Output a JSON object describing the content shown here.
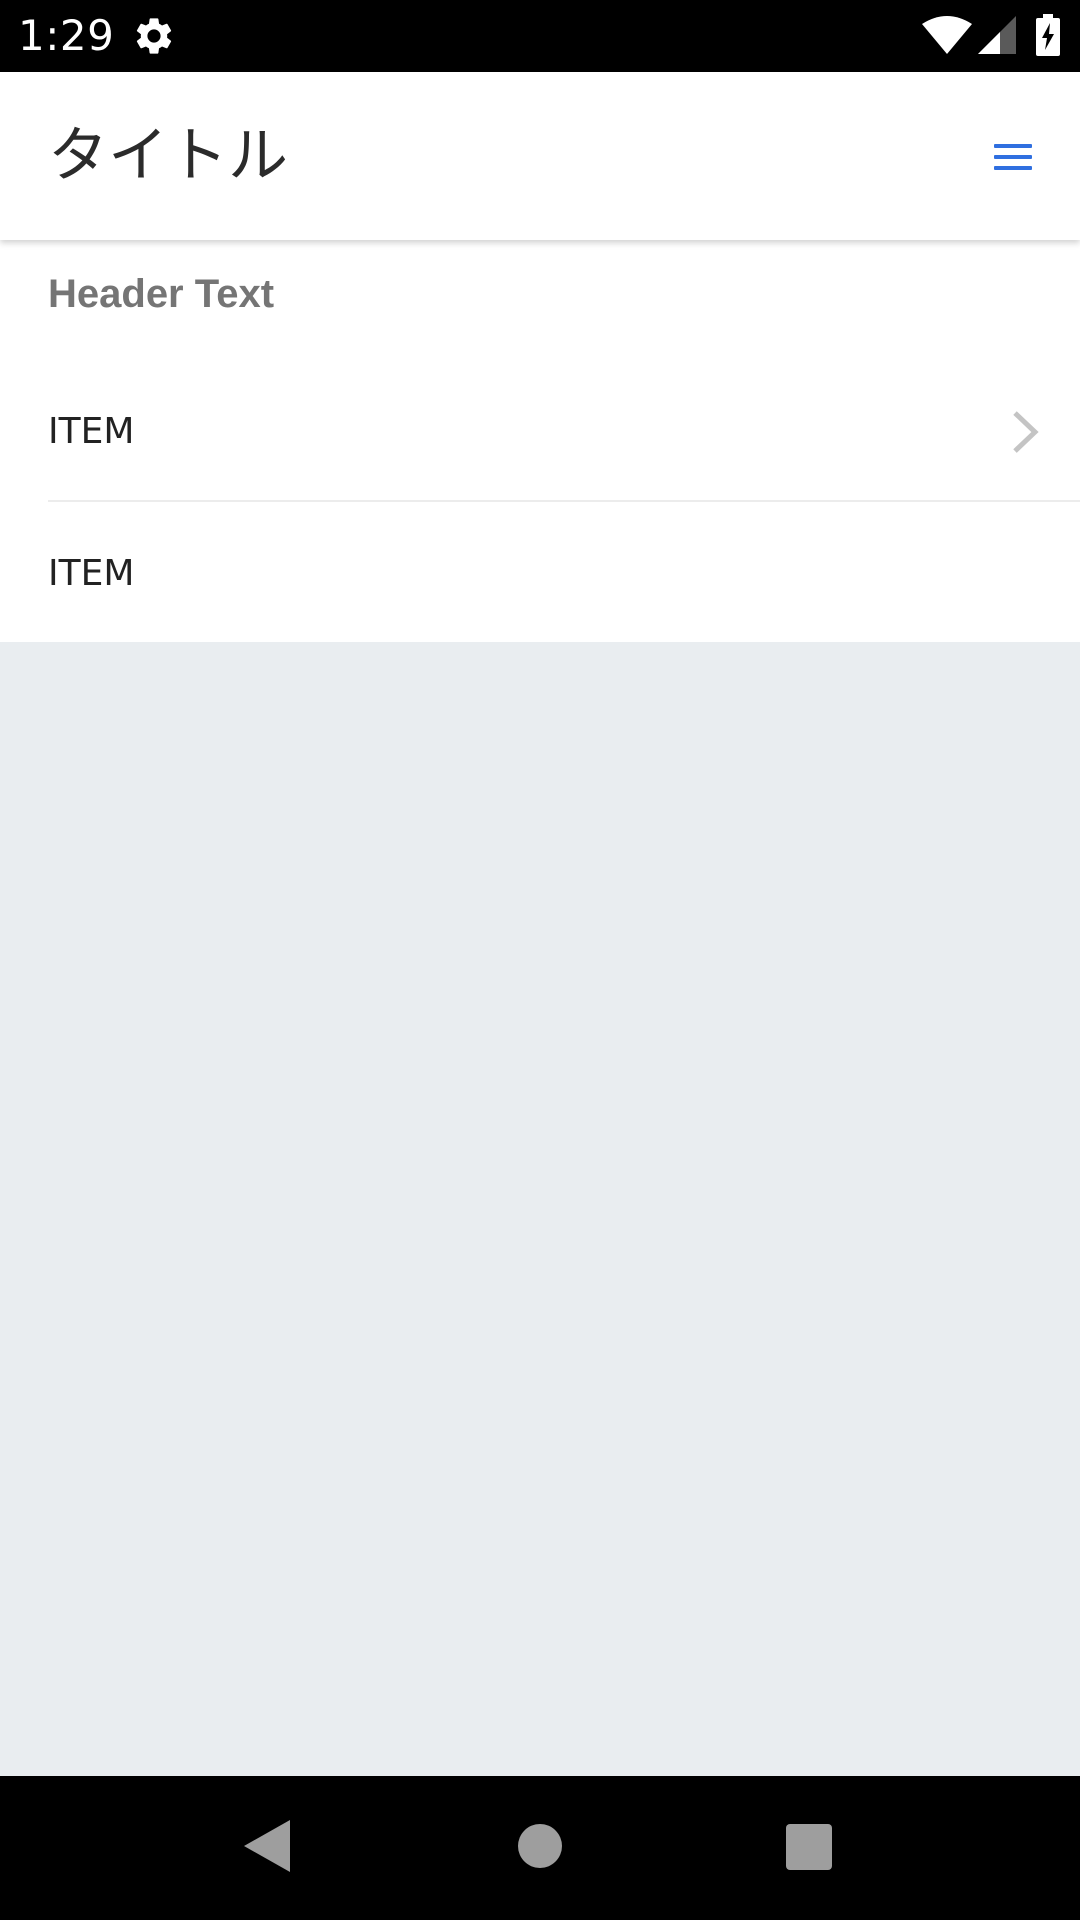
{
  "status_bar": {
    "time": "1:29",
    "icons": [
      "settings-icon",
      "wifi-icon",
      "signal-icon",
      "battery-charging-icon"
    ]
  },
  "app_bar": {
    "title": "タイトル",
    "menu_icon": "hamburger-menu-icon",
    "accent_color": "#2f6fe0"
  },
  "content": {
    "header_text": "Header Text",
    "items": [
      {
        "label": "ITEM",
        "has_chevron": true
      },
      {
        "label": "ITEM",
        "has_chevron": false
      }
    ],
    "chevron_icon": "chevron-right-icon"
  },
  "colors": {
    "background_gray": "#e9edf0",
    "header_text_color": "#757575"
  },
  "nav_bar": {
    "icons": [
      "back-icon",
      "home-icon",
      "recents-icon"
    ]
  }
}
